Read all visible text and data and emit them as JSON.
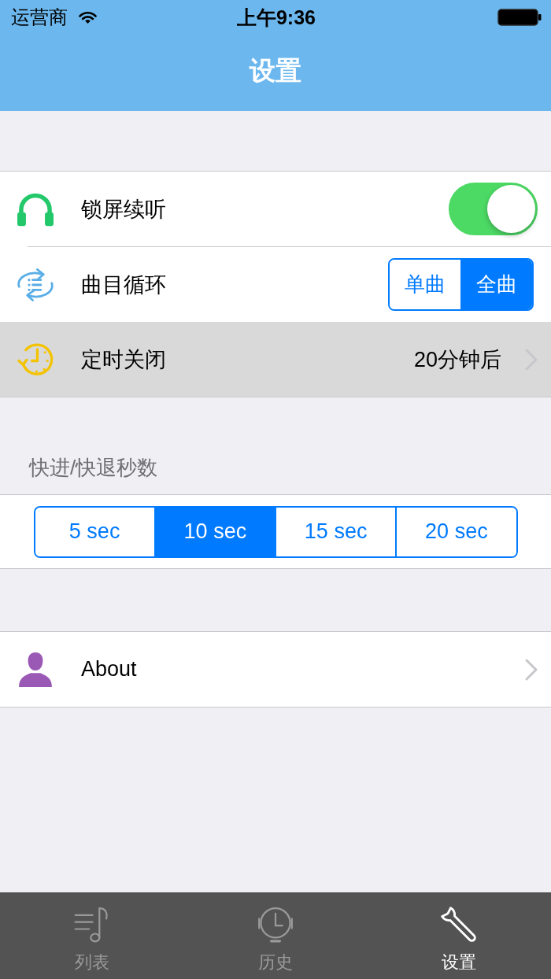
{
  "status_bar": {
    "carrier": "运营商",
    "time": "上午9:36"
  },
  "nav_bar": {
    "title": "设置"
  },
  "playback_group": {
    "rows": [
      {
        "kind": "toggle",
        "label": "锁屏续听",
        "on": true
      },
      {
        "kind": "segmented",
        "label": "曲目循环",
        "options": [
          {
            "label": "单曲",
            "selected": false
          },
          {
            "label": "全曲",
            "selected": true
          }
        ]
      },
      {
        "kind": "disclosure",
        "label": "定时关闭",
        "value": "20分钟后",
        "highlighted": true
      }
    ]
  },
  "seek_section": {
    "header": "快进/快退秒数",
    "segments": [
      {
        "label": "5 sec",
        "selected": false
      },
      {
        "label": "10 sec",
        "selected": true
      },
      {
        "label": "15 sec",
        "selected": false
      },
      {
        "label": "20 sec",
        "selected": false
      }
    ]
  },
  "about_group": {
    "rows": [
      {
        "kind": "disclosure",
        "label": "About",
        "highlighted": false
      }
    ]
  },
  "tab_bar": {
    "tabs": [
      {
        "label": "列表",
        "selected": false
      },
      {
        "label": "历史",
        "selected": false
      },
      {
        "label": "设置",
        "selected": true
      }
    ]
  }
}
